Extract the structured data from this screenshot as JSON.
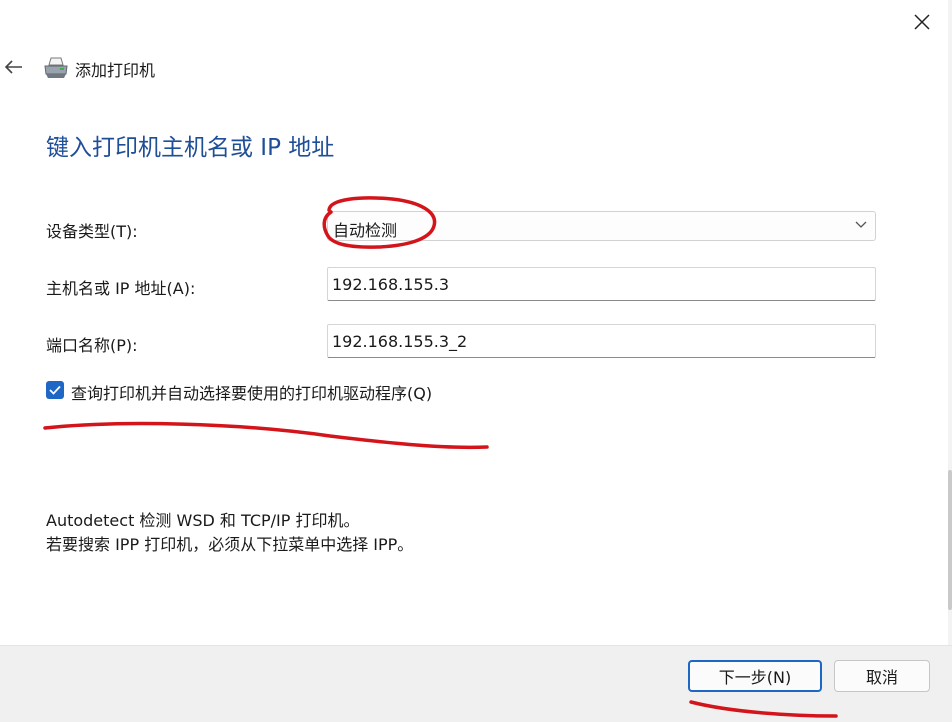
{
  "window": {
    "title": "添加打印机",
    "close_icon": "close-icon",
    "back_icon": "back-arrow-icon",
    "printer_icon": "printer-icon"
  },
  "page": {
    "heading": "键入打印机主机名或 IP 地址"
  },
  "form": {
    "device_type": {
      "label": "设备类型(T):",
      "value": "自动检测"
    },
    "hostname": {
      "label": "主机名或 IP 地址(A):",
      "value": "192.168.155.3"
    },
    "port_name": {
      "label": "端口名称(P):",
      "value": "192.168.155.3_2"
    },
    "query_printer": {
      "label": "查询打印机并自动选择要使用的打印机驱动程序(Q)",
      "checked": true
    }
  },
  "help": {
    "line1": "Autodetect 检测 WSD 和 TCP/IP 打印机。",
    "line2": "若要搜索 IPP 打印机，必须从下拉菜单中选择 IPP。"
  },
  "footer": {
    "next_label": "下一步(N)",
    "cancel_label": "取消"
  },
  "colors": {
    "heading": "#1f4e99",
    "accent": "#1f67c4",
    "annotation": "#d4141b",
    "footer_bg": "#f0f0f0"
  }
}
